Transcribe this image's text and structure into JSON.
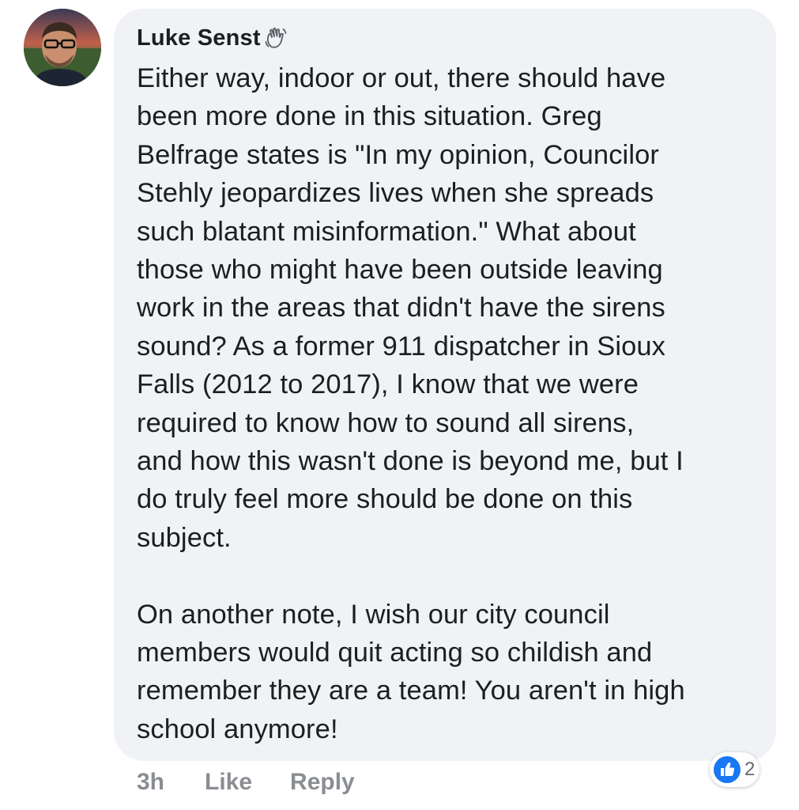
{
  "comment": {
    "author": "Luke Senst",
    "author_badge_icon": "waving-hand-icon",
    "paragraphs": [
      "Either way, indoor or out, there should have\nbeen more done in this situation. Greg\nBelfrage states is \"In my opinion, Councilor\nStehly jeopardizes lives when she spreads\nsuch blatant misinformation.\" What about\nthose who might have been outside leaving\nwork in the areas that didn't have the sirens\nsound? As a former 911 dispatcher in Sioux\nFalls (2012 to 2017), I know that we were\nrequired to know how to sound all sirens,\nand how this wasn't done is beyond me, but I\ndo truly feel more should be done on this\nsubject.",
      "On another note, I wish our city council\nmembers would quit acting so childish and\nremember they are a team! You aren't in high\nschool anymore!"
    ]
  },
  "actions": {
    "timestamp": "3h",
    "like_label": "Like",
    "reply_label": "Reply"
  },
  "reactions": {
    "icon": "like-thumb-icon",
    "count": "2"
  },
  "colors": {
    "bubble_bg": "#f0f2f5",
    "text": "#1c1e21",
    "muted": "#8a8d91",
    "like_blue": "#1877f2"
  }
}
